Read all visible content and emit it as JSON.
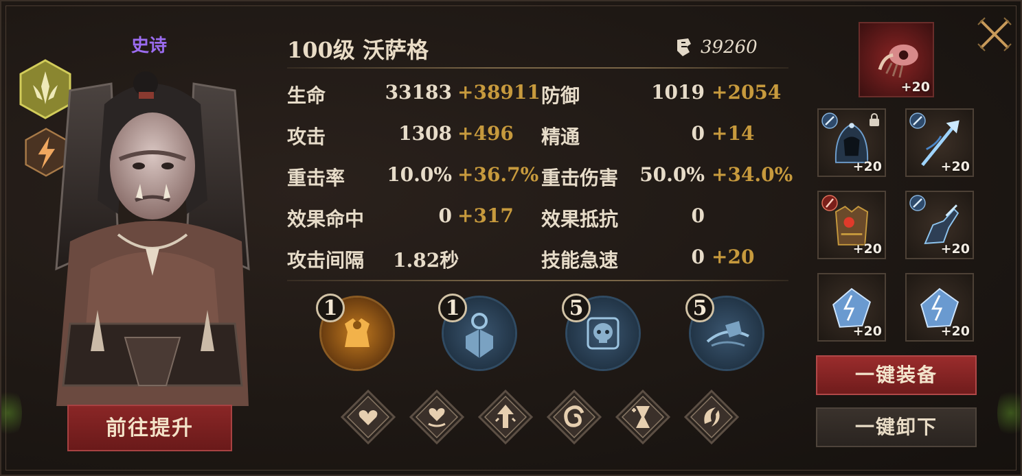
{
  "hero": {
    "rarity": "史诗",
    "title": "100级 沃萨格",
    "power": "39260",
    "upgrade_button": "前往提升"
  },
  "stats": [
    {
      "label": "生命",
      "base": "33183",
      "bonus": "+38911"
    },
    {
      "label": "防御",
      "base": "1019",
      "bonus": "+2054"
    },
    {
      "label": "攻击",
      "base": "1308",
      "bonus": "+496"
    },
    {
      "label": "精通",
      "base": "0",
      "bonus": "+14"
    },
    {
      "label": "重击率",
      "base": "10.0%",
      "bonus": "+36.7%"
    },
    {
      "label": "重击伤害",
      "base": "50.0%",
      "bonus": "+34.0%"
    },
    {
      "label": "效果命中",
      "base": "0",
      "bonus": "+317"
    },
    {
      "label": "效果抵抗",
      "base": "0",
      "bonus": ""
    },
    {
      "label": "攻击间隔",
      "base": "1.82秒",
      "bonus": ""
    },
    {
      "label": "技能急速",
      "base": "0",
      "bonus": "+20"
    }
  ],
  "skills": [
    {
      "level": "1",
      "icon": "armor-skill-icon"
    },
    {
      "level": "1",
      "icon": "shield-skill-icon"
    },
    {
      "level": "5",
      "icon": "skull-skill-icon"
    },
    {
      "level": "5",
      "icon": "axe-skill-icon"
    }
  ],
  "traits": [
    {
      "icon": "heart-icon"
    },
    {
      "icon": "heart-heal-icon"
    },
    {
      "icon": "arrow-up-icon"
    },
    {
      "icon": "swirl-icon"
    },
    {
      "icon": "hourglass-icon"
    },
    {
      "icon": "crescent-spin-icon"
    }
  ],
  "equipment": {
    "top": {
      "level": "+20",
      "icon": "claw-weapon-icon"
    },
    "slots": [
      {
        "level": "+20",
        "icon": "hood-icon"
      },
      {
        "level": "+20",
        "icon": "bow-icon"
      },
      {
        "level": "+20",
        "icon": "chest-armor-icon"
      },
      {
        "level": "+20",
        "icon": "gauntlet-icon"
      },
      {
        "level": "+20",
        "icon": "crystal-icon"
      },
      {
        "level": "+20",
        "icon": "crystal-icon"
      }
    ],
    "equip_all": "一键装备",
    "unequip_all": "一键卸下"
  },
  "colors": {
    "rarity": "#9b6cf0",
    "bonus": "#c79a3d",
    "primary_button": "#8a2626"
  }
}
